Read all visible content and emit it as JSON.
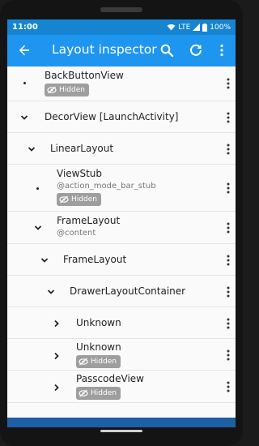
{
  "status_bar": {
    "time": "11:00",
    "network": "LTE",
    "battery": "100%"
  },
  "app_bar": {
    "title": "Layout inspector",
    "icons": [
      "back-arrow-icon",
      "search-icon",
      "refresh-icon",
      "more-vert-icon"
    ]
  },
  "tree": [
    {
      "name": "BackButtonView",
      "sub": "",
      "hidden": true,
      "expander": "leaf",
      "depth": 0
    },
    {
      "name": "DecorView [LaunchActivity]",
      "sub": "",
      "hidden": false,
      "expander": "expanded",
      "depth": 0
    },
    {
      "name": "LinearLayout",
      "sub": "",
      "hidden": false,
      "expander": "expanded",
      "depth": 1
    },
    {
      "name": "ViewStub",
      "sub": "@action_mode_bar_stub",
      "hidden": true,
      "expander": "leaf",
      "depth": 2
    },
    {
      "name": "FrameLayout",
      "sub": "@content",
      "hidden": false,
      "expander": "expanded",
      "depth": 2
    },
    {
      "name": "FrameLayout",
      "sub": "",
      "hidden": false,
      "expander": "expanded",
      "depth": 3
    },
    {
      "name": "DrawerLayoutContainer",
      "sub": "",
      "hidden": false,
      "expander": "expanded",
      "depth": 4
    },
    {
      "name": "Unknown",
      "sub": "",
      "hidden": false,
      "expander": "collapsed",
      "depth": 5
    },
    {
      "name": "Unknown",
      "sub": "",
      "hidden": true,
      "expander": "collapsed",
      "depth": 5
    },
    {
      "name": "PasscodeView",
      "sub": "",
      "hidden": true,
      "expander": "collapsed",
      "depth": 5
    }
  ],
  "hidden_label": "Hidden",
  "colors": {
    "appbar": "#1e96f0",
    "statusbar": "#1584d1",
    "badge": "#9e9e9e"
  }
}
